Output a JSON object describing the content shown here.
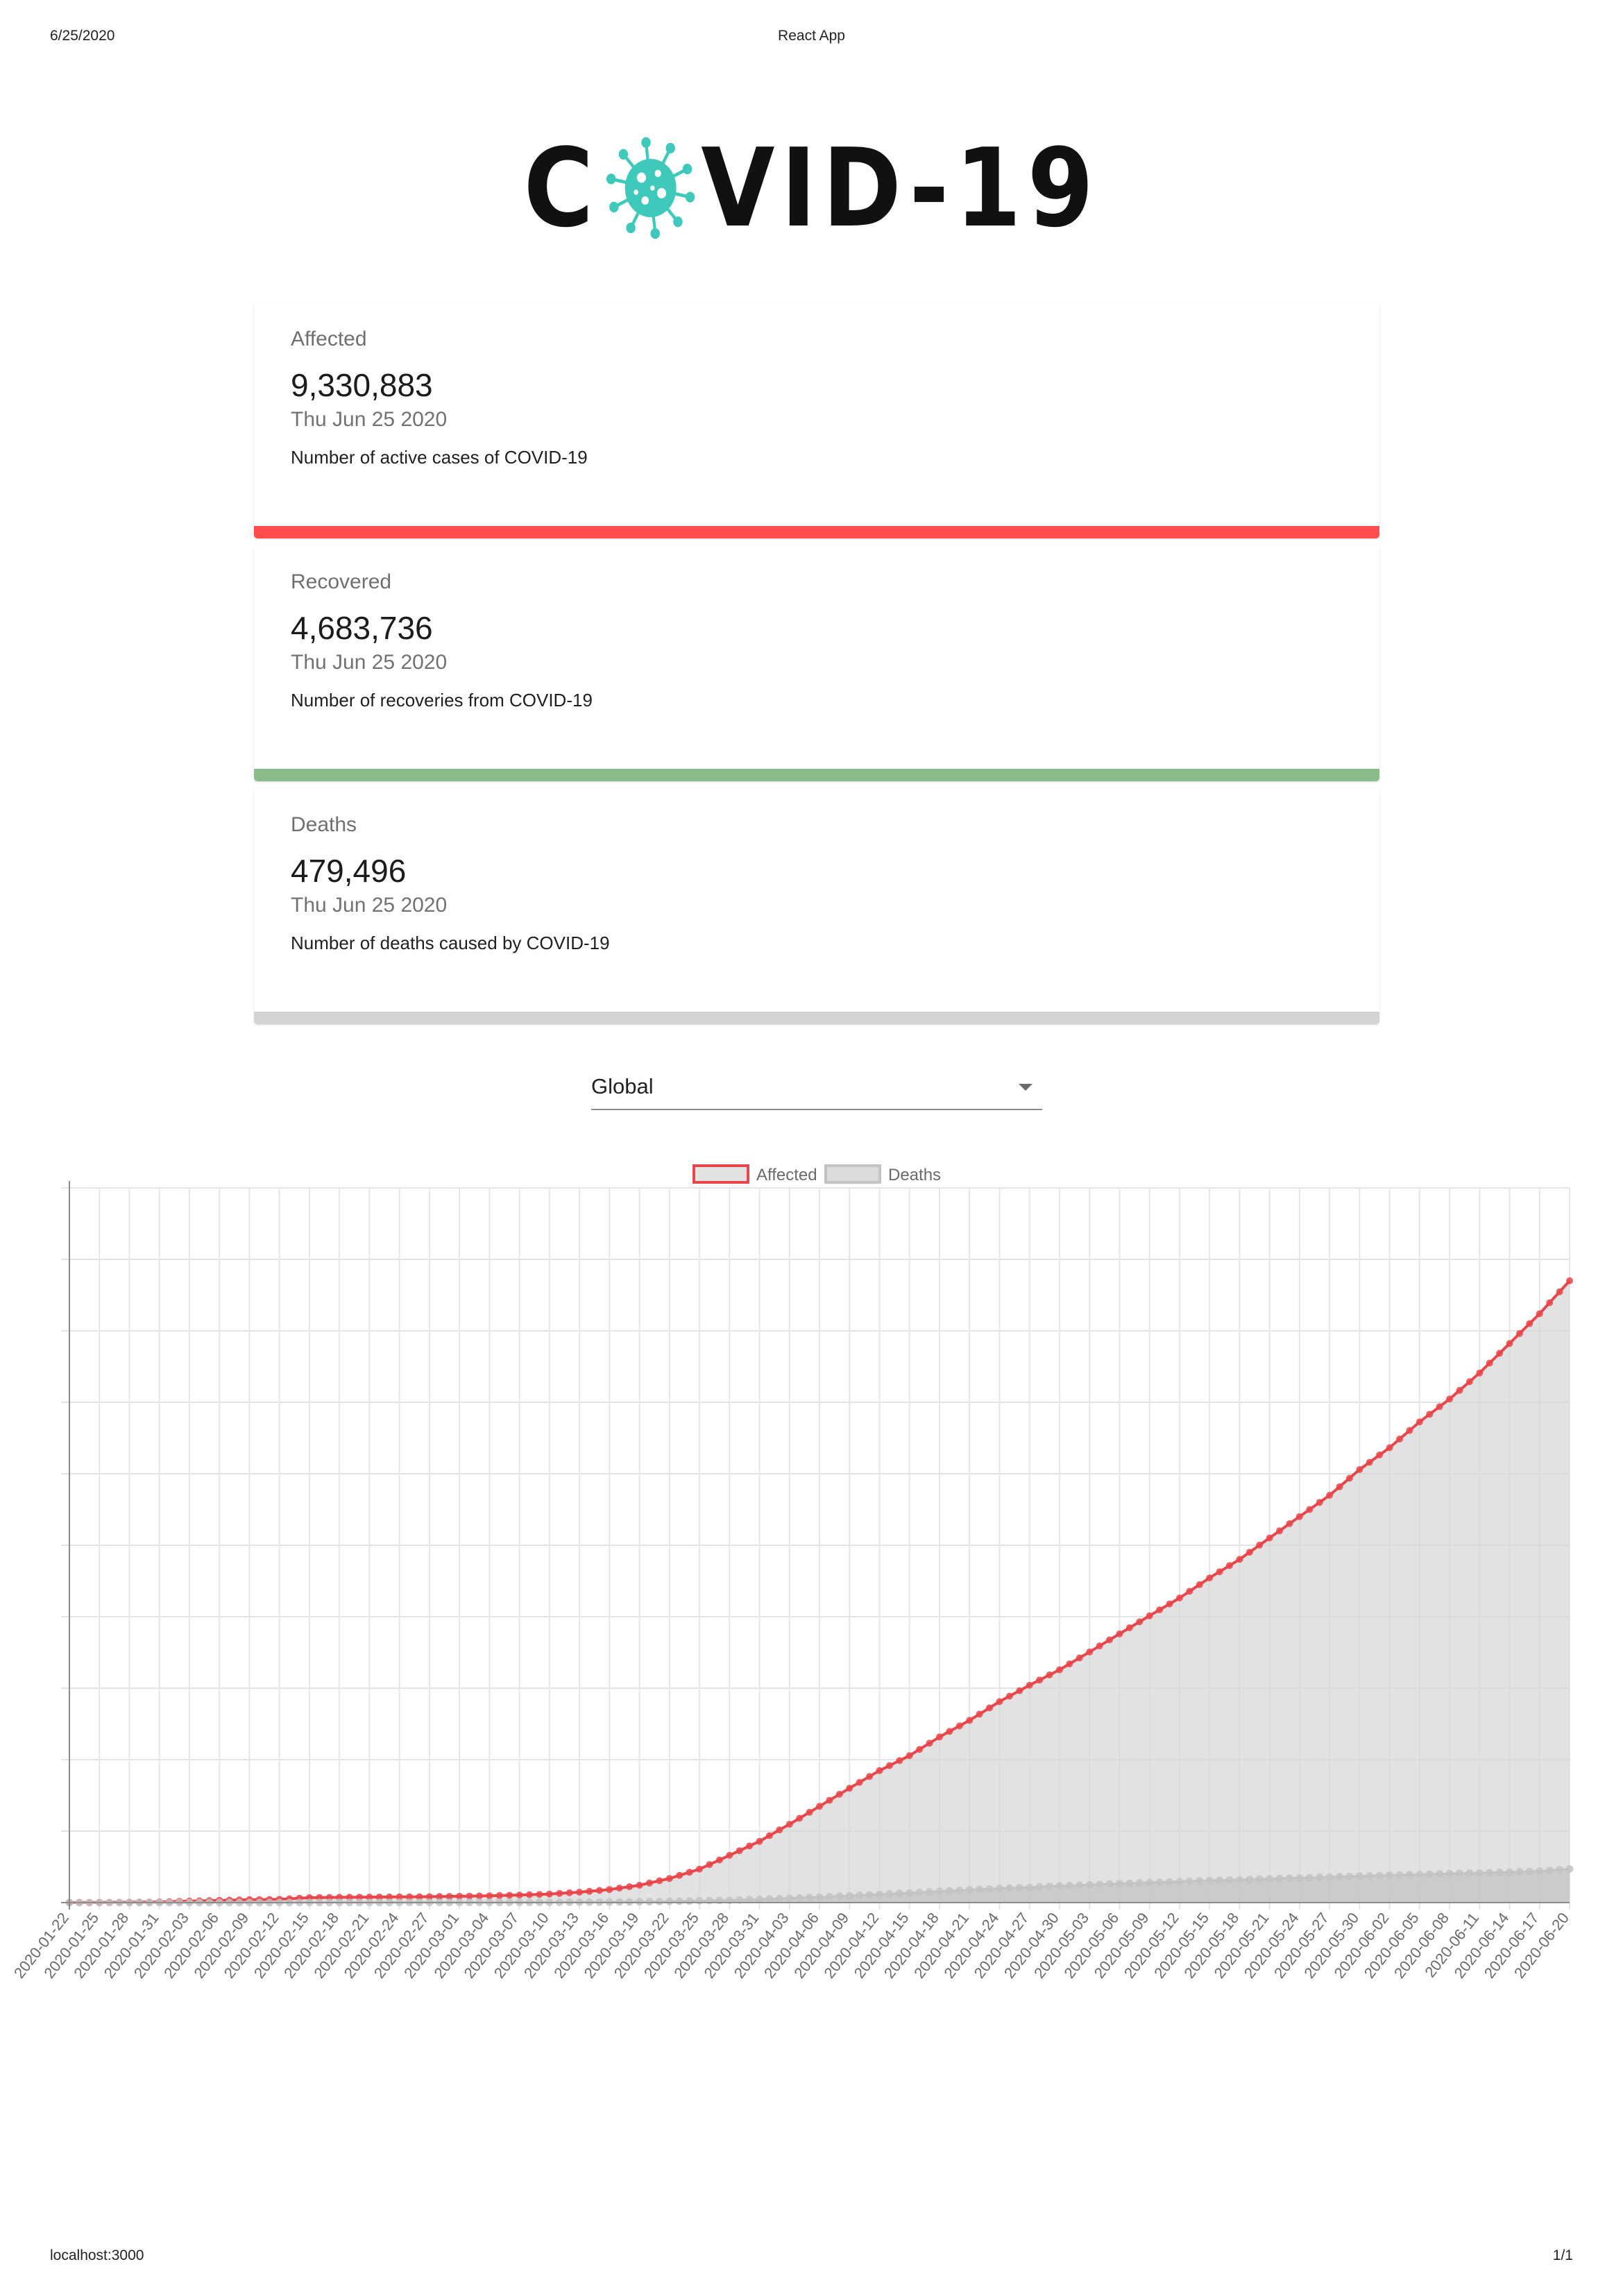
{
  "print": {
    "date": "6/25/2020",
    "title": "React App",
    "url": "localhost:3000",
    "page": "1/1"
  },
  "logo": {
    "text_before": "C",
    "text_after": "VID-19",
    "virus_color": "#3ec9bb"
  },
  "cards": [
    {
      "title": "Affected",
      "value": "9,330,883",
      "date": "Thu Jun 25 2020",
      "description": "Number of active cases of COVID-19",
      "color": "#ff4c4c"
    },
    {
      "title": "Recovered",
      "value": "4,683,736",
      "date": "Thu Jun 25 2020",
      "description": "Number of recoveries from COVID-19",
      "color": "#8bbd8b"
    },
    {
      "title": "Deaths",
      "value": "479,496",
      "date": "Thu Jun 25 2020",
      "description": "Number of deaths caused by COVID-19",
      "color": "#d3d3d3"
    }
  ],
  "country_select": {
    "value": "Global"
  },
  "chart_data": {
    "type": "line",
    "grid": true,
    "legend_position": "top",
    "x": [
      "2020-01-22",
      "2020-01-25",
      "2020-01-28",
      "2020-01-31",
      "2020-02-03",
      "2020-02-06",
      "2020-02-09",
      "2020-02-12",
      "2020-02-15",
      "2020-02-18",
      "2020-02-21",
      "2020-02-24",
      "2020-02-27",
      "2020-03-01",
      "2020-03-04",
      "2020-03-07",
      "2020-03-10",
      "2020-03-13",
      "2020-03-16",
      "2020-03-19",
      "2020-03-22",
      "2020-03-25",
      "2020-03-28",
      "2020-03-31",
      "2020-04-03",
      "2020-04-06",
      "2020-04-09",
      "2020-04-12",
      "2020-04-15",
      "2020-04-18",
      "2020-04-21",
      "2020-04-24",
      "2020-04-27",
      "2020-04-30",
      "2020-05-03",
      "2020-05-06",
      "2020-05-09",
      "2020-05-12",
      "2020-05-15",
      "2020-05-18",
      "2020-05-21",
      "2020-05-24",
      "2020-05-27",
      "2020-05-30",
      "2020-06-02",
      "2020-06-05",
      "2020-06-08",
      "2020-06-11",
      "2020-06-14",
      "2020-06-17",
      "2020-06-20"
    ],
    "series": [
      {
        "name": "Affected",
        "color": "#e8464a",
        "fill": "rgba(215,215,215,0.72)",
        "values": [
          555,
          2927,
          5578,
          9927,
          20630,
          31211,
          40553,
          45220,
          69032,
          73332,
          76842,
          79558,
          82744,
          88585,
          95124,
          105847,
          119132,
          145205,
          182405,
          242713,
          337020,
          467653,
          660706,
          857487,
          1095917,
          1346299,
          1600000,
          1846680,
          2056055,
          2317759,
          2549294,
          2811193,
          3041764,
          3256853,
          3506729,
          3760046,
          4012857,
          4261747,
          4542347,
          4801943,
          5102424,
          5401222,
          5698917,
          6057853,
          6365173,
          6726179,
          7045785,
          7410510,
          7823289,
          8240000,
          8700000
        ]
      },
      {
        "name": "Deaths",
        "color": "#c3c3c3",
        "fill": "rgba(195,195,195,0.75)",
        "values": [
          17,
          81,
          133,
          213,
          427,
          636,
          910,
          1115,
          1666,
          1873,
          2251,
          2469,
          2804,
          2996,
          3348,
          3584,
          4262,
          5392,
          7126,
          11402,
          16509,
          25251,
          33256,
          44149,
          59172,
          74546,
          95721,
          114170,
          134180,
          157847,
          177641,
          197159,
          211609,
          233388,
          247470,
          264837,
          279311,
          292046,
          308645,
          318789,
          332924,
          344117,
          356417,
          370000,
          381000,
          393000,
          404000,
          414000,
          426000,
          440000,
          470000
        ]
      }
    ],
    "ylim": [
      0,
      10000000
    ]
  }
}
